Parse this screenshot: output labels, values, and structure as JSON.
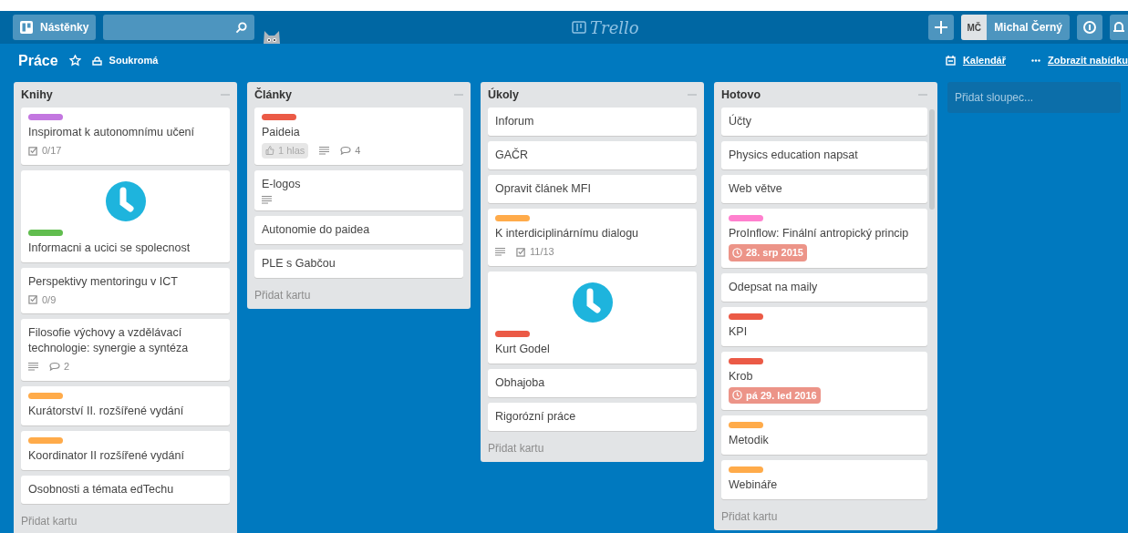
{
  "header": {
    "boards_button": "Nástěnky",
    "logo": "Trello",
    "avatar": "MČ",
    "user_name": "Michal Černý"
  },
  "board": {
    "title": "Práce",
    "starred": false,
    "visibility": "Soukromá",
    "calendar_link": "Kalendář",
    "menu_link": "Zobrazit nabídku"
  },
  "lists": [
    {
      "title": "Knihy",
      "add_card": "Přidat kartu",
      "cards": [
        {
          "label": {
            "color": "#c377e0"
          },
          "title": "Inspiromat k autonomnímu učení",
          "badges": [
            {
              "kind": "checklist",
              "text": "0/17"
            }
          ]
        },
        {
          "cover": true,
          "label": {
            "color": "#61bd4f"
          },
          "title": "Informacni a ucici se spolecnost"
        },
        {
          "title": "Perspektivy mentoringu v ICT",
          "badges": [
            {
              "kind": "checklist",
              "text": "0/9"
            }
          ]
        },
        {
          "title": "Filosofie výchovy a vzdělávací technologie: synergie a syntéza",
          "badges": [
            {
              "kind": "description"
            },
            {
              "kind": "comments",
              "text": "2"
            }
          ]
        },
        {
          "label": {
            "color": "#ffab4a"
          },
          "title": "Kurátorství II. rozšířené vydání"
        },
        {
          "label": {
            "color": "#ffab4a"
          },
          "title": "Koordinator II rozšířené vydání"
        },
        {
          "title": "Osobnosti a témata edTechu"
        }
      ]
    },
    {
      "title": "Články",
      "add_card": "Přidat kartu",
      "cards": [
        {
          "label": {
            "color": "#eb5a46"
          },
          "title": "Paideia",
          "badges": [
            {
              "kind": "votes",
              "text": "1 hlas"
            },
            {
              "kind": "description"
            },
            {
              "kind": "comments",
              "text": "4"
            }
          ]
        },
        {
          "title": "E-logos",
          "badges": [
            {
              "kind": "description"
            }
          ]
        },
        {
          "title": "Autonomie do paidea"
        },
        {
          "title": "PLE s Gabčou"
        }
      ]
    },
    {
      "title": "Úkoly",
      "add_card": "Přidat kartu",
      "cards": [
        {
          "title": "Inforum"
        },
        {
          "title": "GAČR"
        },
        {
          "title": "Opravit článek MFI"
        },
        {
          "label": {
            "color": "#ffab4a"
          },
          "title": "K interdiciplinárnímu dialogu",
          "badges": [
            {
              "kind": "description"
            },
            {
              "kind": "checklist",
              "text": "11/13"
            }
          ]
        },
        {
          "cover": true,
          "label": {
            "color": "#eb5a46"
          },
          "title": "Kurt Godel"
        },
        {
          "title": "Obhajoba"
        },
        {
          "title": "Rigorózní práce"
        }
      ]
    },
    {
      "title": "Hotovo",
      "add_card": "Přidat kartu",
      "scrollbar": true,
      "cards": [
        {
          "title": "Účty"
        },
        {
          "title": "Physics education napsat"
        },
        {
          "title": "Web větve"
        },
        {
          "label": {
            "color": "#ff80ce"
          },
          "title": "ProInflow: Finální antropický princip",
          "badges": [
            {
              "kind": "due",
              "text": "28. srp 2015"
            }
          ]
        },
        {
          "title": "Odepsat na maily"
        },
        {
          "label": {
            "color": "#eb5a46"
          },
          "title": "KPI"
        },
        {
          "label": {
            "color": "#eb5a46"
          },
          "title": "Krob",
          "badges": [
            {
              "kind": "due",
              "text": "pá 29. led 2016"
            }
          ]
        },
        {
          "label": {
            "color": "#ffab4a"
          },
          "title": "Metodik"
        },
        {
          "label": {
            "color": "#ffab4a"
          },
          "title": "Webináře"
        }
      ]
    }
  ],
  "add_list": "Přidat sloupec..."
}
